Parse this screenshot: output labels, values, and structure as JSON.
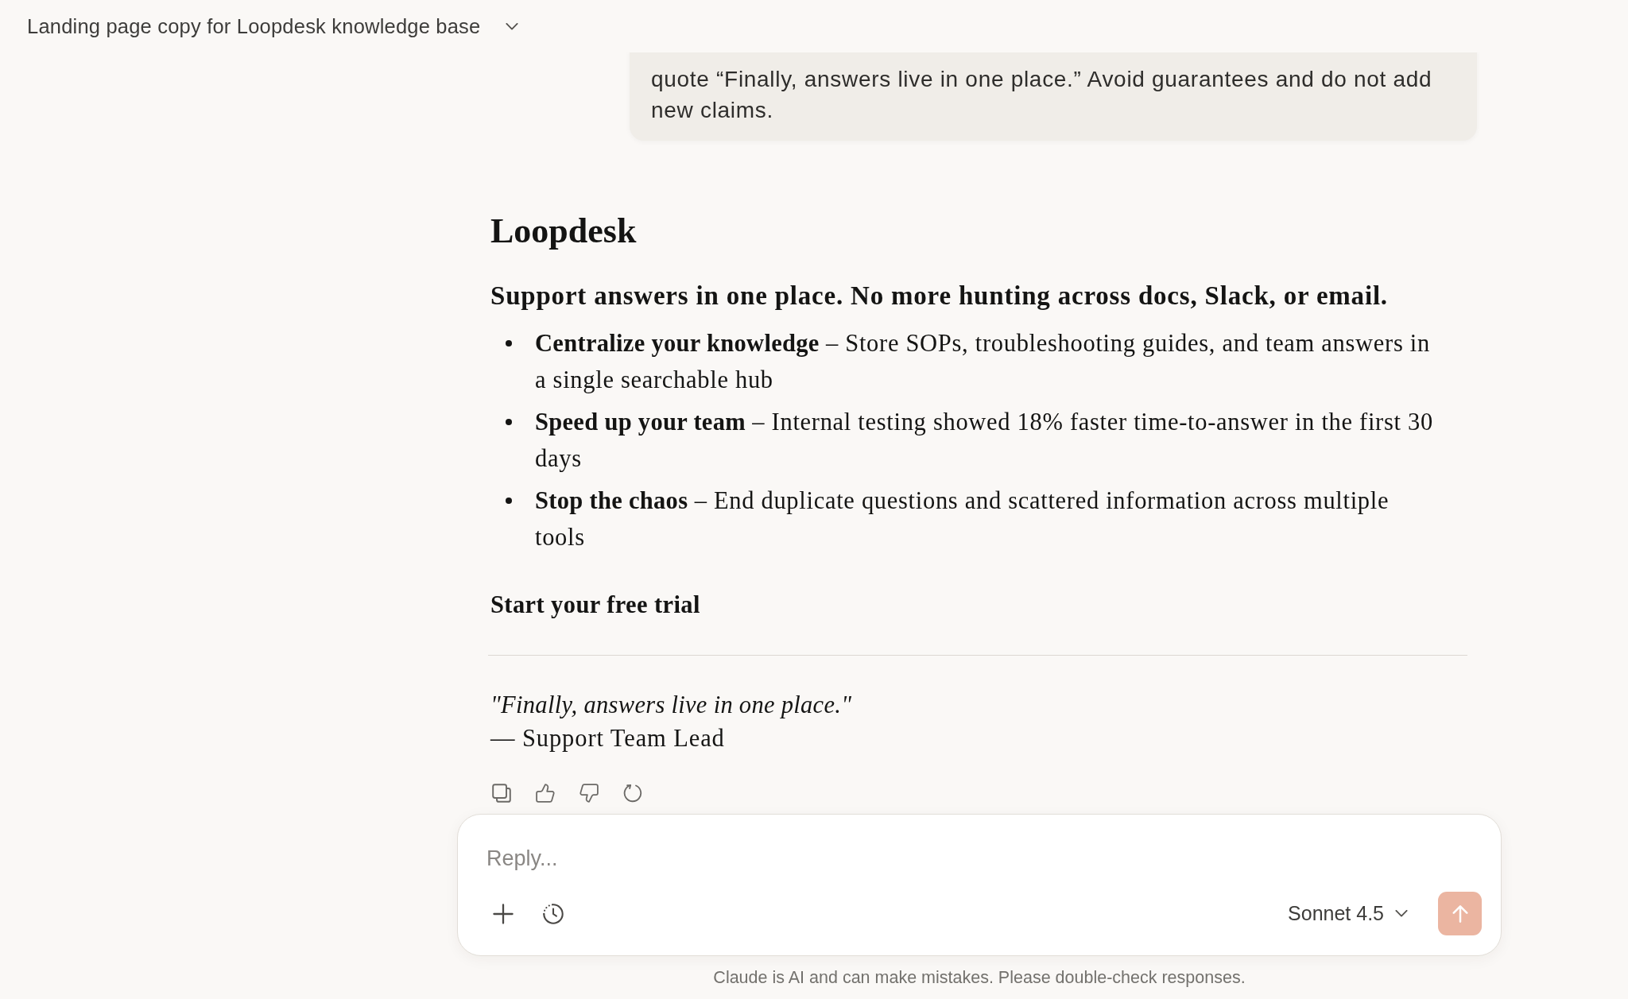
{
  "header": {
    "title": "Landing page copy for Loopdesk knowledge base"
  },
  "user_message": {
    "text": "quote “Finally, answers live in one place.” Avoid guarantees and do not add new claims."
  },
  "response": {
    "heading": "Loopdesk",
    "subheading": "Support answers in one place. No more hunting across docs, Slack, or email.",
    "bullets": [
      "**Centralize your knowledge** – Store SOPs, troubleshooting guides, and team answers in a single searchable hub",
      "**Speed up your team** – Internal testing showed 18% faster time-to-answer in the first 30 days",
      "**Stop the chaos** – End duplicate questions and scattered information across multiple tools"
    ],
    "cta": "Start your free trial",
    "quote": "\"Finally, answers live in one place.\"",
    "attribution": "— Support Team Lead"
  },
  "composer": {
    "placeholder": "Reply...",
    "model": "Sonnet 4.5",
    "send_button": {
      "disabled": true
    }
  },
  "disclaimer": "Claude is AI and can make mistakes. Please double-check responses."
}
